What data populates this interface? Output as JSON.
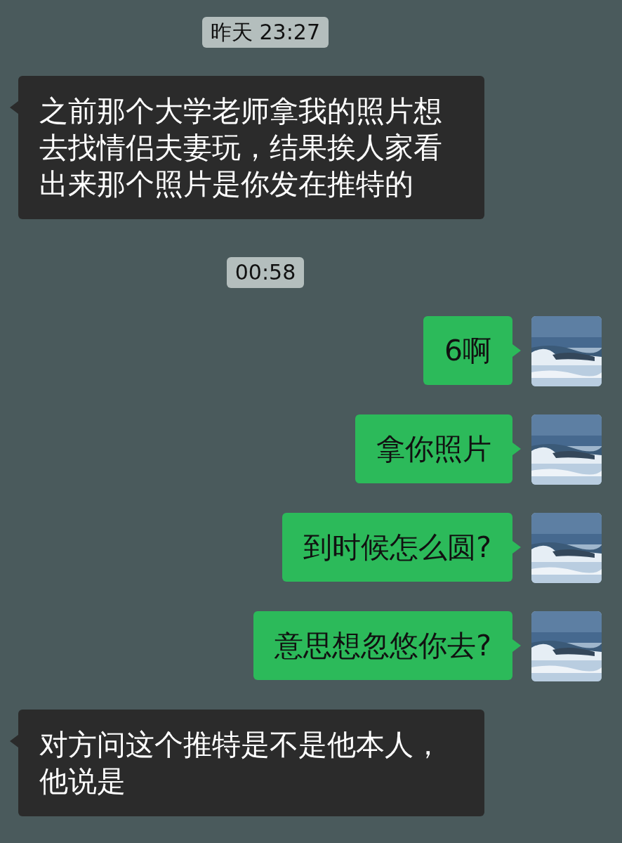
{
  "messages": [
    {
      "kind": "time",
      "text": "昨天 23:27"
    },
    {
      "kind": "incoming",
      "text": "之前那个大学老师拿我的照片想去找情侣夫妻玩，结果挨人家看出来那个照片是你发在推特的"
    },
    {
      "kind": "time",
      "text": "00:58"
    },
    {
      "kind": "outgoing",
      "text": "6啊"
    },
    {
      "kind": "outgoing",
      "text": "拿你照片"
    },
    {
      "kind": "outgoing",
      "text": "到时候怎么圆?"
    },
    {
      "kind": "outgoing",
      "text": "意思想忽悠你去?"
    },
    {
      "kind": "incoming",
      "text": "对方问这个推特是不是他本人，他说是"
    }
  ]
}
